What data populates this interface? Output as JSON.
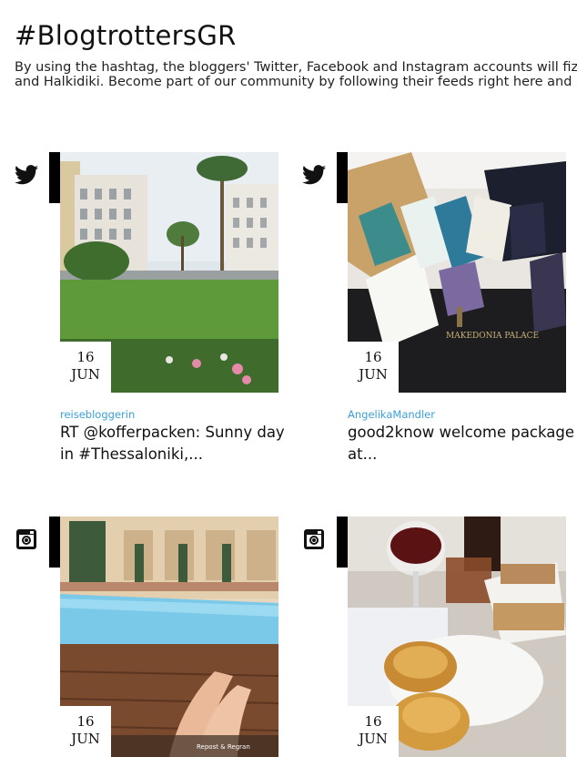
{
  "header": {
    "title": "#BlogtrottersGR",
    "intro_line1": "By using the hashtag, the bloggers' Twitter, Facebook and Instagram accounts will fizz",
    "intro_line2": "and Halkidiki. Become part of our community by following their feeds right here and sha"
  },
  "posts": [
    {
      "network": "twitter-icon",
      "day": "16",
      "month": "JUN",
      "author": "reisebloggerin",
      "text": "RT @kofferpacken: Sunny day in #Thessaloniki,..."
    },
    {
      "network": "twitter-icon",
      "day": "16",
      "month": "JUN",
      "author": "AngelikaMandler",
      "text": "good2know welcome package at...",
      "photo_text": "MAKEDONIA PALACE"
    },
    {
      "network": "instagram-icon",
      "day": "16",
      "month": "JUN",
      "photo_text": "Repost & Regran"
    },
    {
      "network": "instagram-icon",
      "day": "16",
      "month": "JUN"
    }
  ],
  "colors": {
    "author_link": "#3aa0d8",
    "accent_bar": "#000000"
  }
}
